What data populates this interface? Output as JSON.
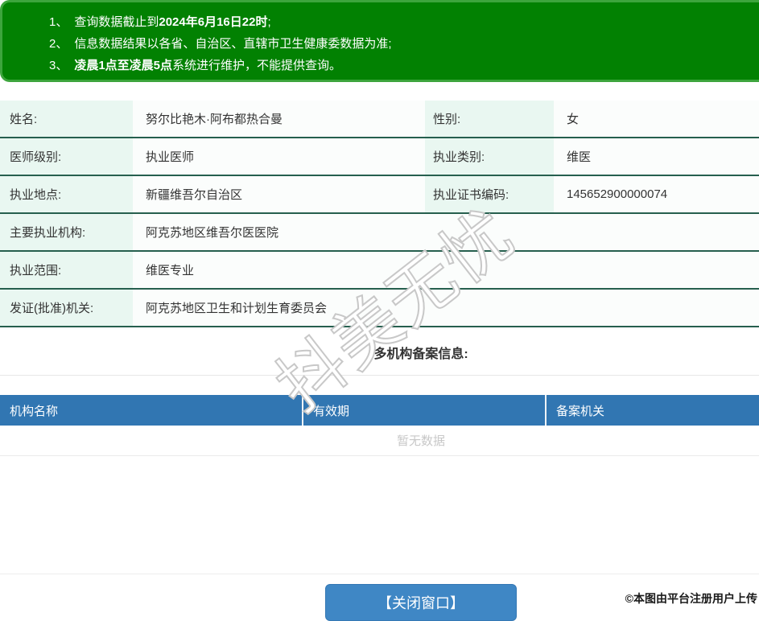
{
  "notice": {
    "items": [
      {
        "num": "1、",
        "pre": "查询数据截止到",
        "bold": "2024年6月16日22时",
        "post": ";"
      },
      {
        "num": "2、",
        "pre": "信息数据结果以各省、自治区、直辖市卫生健康委数据为准;",
        "bold": "",
        "post": ""
      },
      {
        "num": "3、",
        "pre": "",
        "bold": "凌晨1点至凌晨5点",
        "post": "系统进行维护，不能提供查询。"
      }
    ]
  },
  "doctor": {
    "name_label": "姓名:",
    "name": "努尔比艳木·阿布都热合曼",
    "gender_label": "性别:",
    "gender": "女",
    "level_label": "医师级别:",
    "level": "执业医师",
    "category_label": "执业类别:",
    "category": "维医",
    "location_label": "执业地点:",
    "location": "新疆维吾尔自治区",
    "cert_no_label": "执业证书编码:",
    "cert_no": "145652900000074",
    "main_org_label": "主要执业机构:",
    "main_org": "阿克苏地区维吾尔医医院",
    "scope_label": "执业范围:",
    "scope": "维医专业",
    "issuer_label": "发证(批准)机关:",
    "issuer": "阿克苏地区卫生和计划生育委员会"
  },
  "filing": {
    "title": "多机构备案信息:",
    "columns": [
      "机构名称",
      "有效期",
      "备案机关"
    ],
    "empty_text": "暂无数据"
  },
  "footer": {
    "close_button": "【关闭窗口】"
  },
  "watermark": {
    "text": "抖美无忧"
  },
  "credit": {
    "text": "©本图由平台注册用户上传"
  },
  "colors": {
    "banner_green": "#028102",
    "banner_border_green": "#3da53d",
    "row_border_green": "#265f4e",
    "label_bg_mint": "#e9f7f1",
    "table_header_blue": "#3176b2",
    "button_blue": "#3f87c5",
    "empty_text_gray": "#c8c8c8"
  }
}
